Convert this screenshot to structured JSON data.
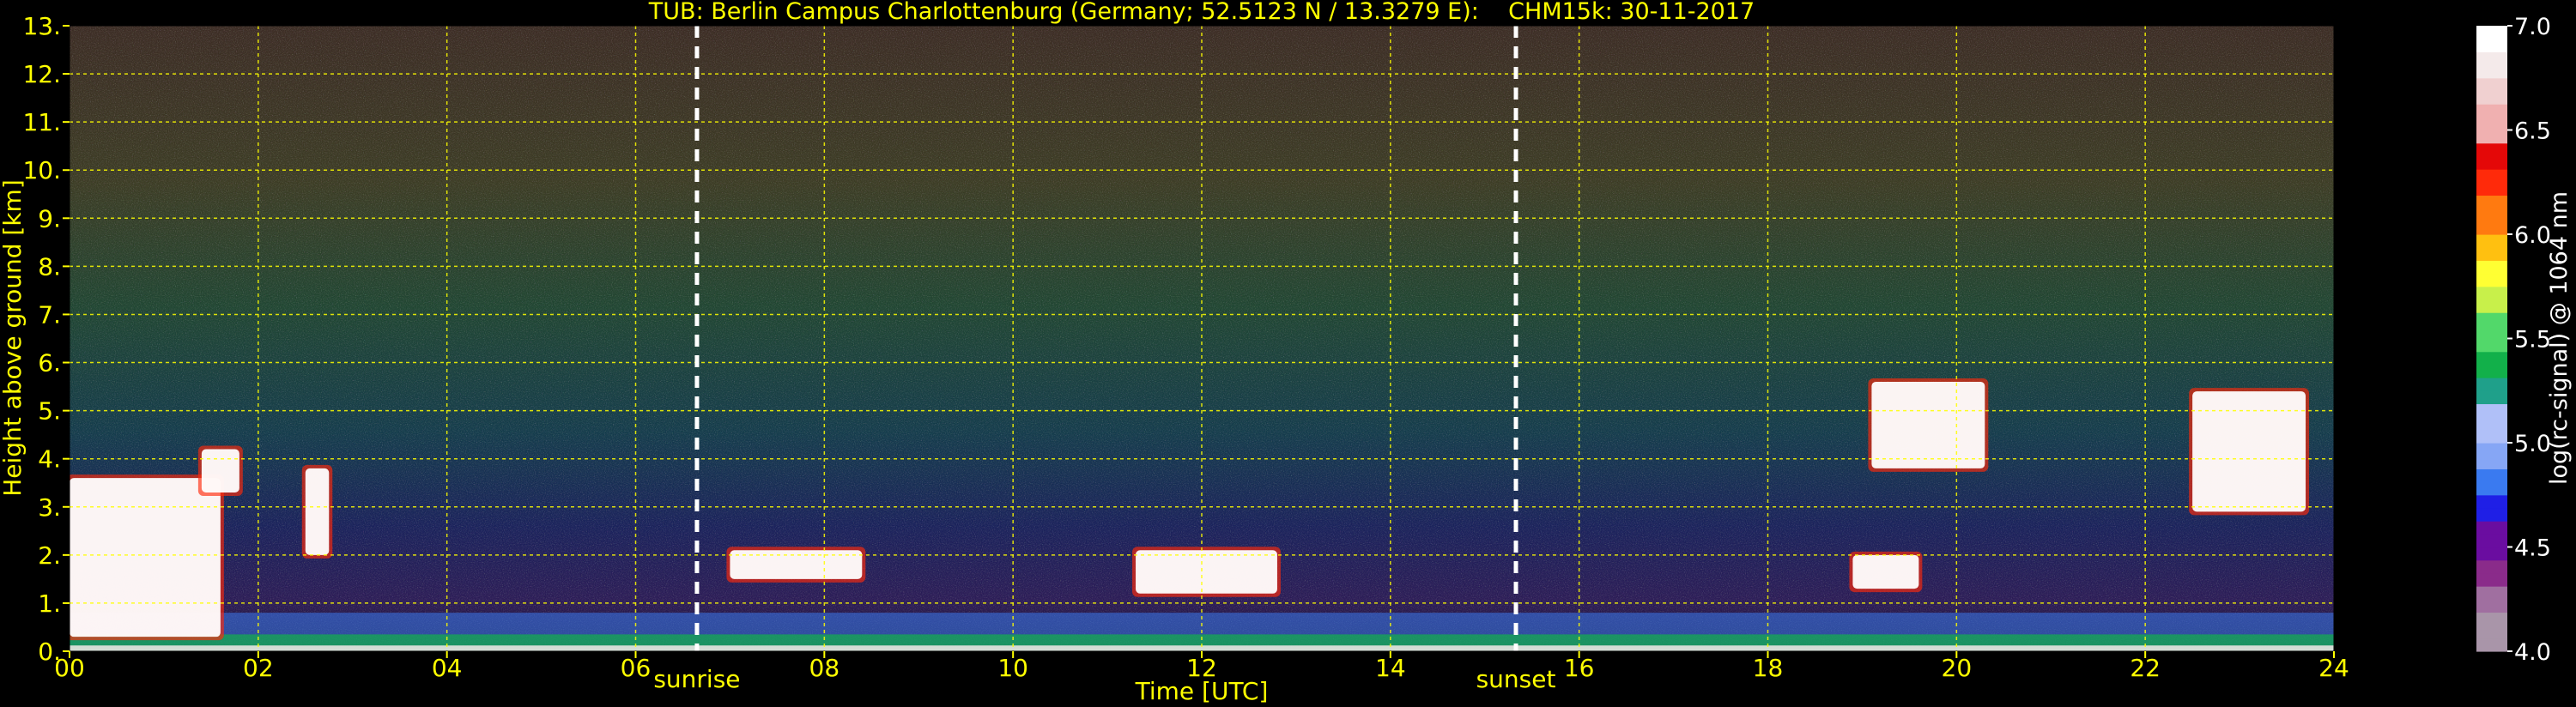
{
  "chart_data": {
    "type": "heatmap",
    "title": "TUB: Berlin Campus Charlottenburg (Germany; 52.5123 N / 13.3279 E):    CHM15k: 30-11-2017",
    "xlabel": "Time [UTC]",
    "ylabel": "Height above ground [km]",
    "xlim": [
      0,
      24
    ],
    "ylim": [
      0,
      13
    ],
    "x_ticks": [
      "00",
      "02",
      "04",
      "06",
      "08",
      "10",
      "12",
      "14",
      "16",
      "18",
      "20",
      "22",
      "24"
    ],
    "y_ticks": [
      "0.",
      "1.",
      "2.",
      "3.",
      "4.",
      "5.",
      "6.",
      "7.",
      "8.",
      "9.",
      "10.",
      "11.",
      "12.",
      "13."
    ],
    "grid": true,
    "markers": [
      {
        "label": "sunrise",
        "time_utc": 6.65
      },
      {
        "label": "sunset",
        "time_utc": 15.33
      }
    ],
    "colorbar": {
      "label": "log(rc-signal) @ 1064 nm",
      "range": [
        4.0,
        7.0
      ],
      "ticks": [
        "4.0",
        "4.5",
        "5.0",
        "5.5",
        "6.0",
        "6.5",
        "7.0"
      ]
    },
    "features": [
      {
        "name": "boundary layer",
        "t": [
          0,
          24
        ],
        "h": [
          0.0,
          0.8
        ]
      },
      {
        "name": "low cloud",
        "t": [
          0.0,
          1.6
        ],
        "h": [
          0.3,
          3.6
        ]
      },
      {
        "name": "cloud",
        "t": [
          1.4,
          1.8
        ],
        "h": [
          3.3,
          4.2
        ]
      },
      {
        "name": "cloud",
        "t": [
          2.5,
          2.75
        ],
        "h": [
          2.0,
          3.8
        ]
      },
      {
        "name": "cloud",
        "t": [
          7.0,
          8.4
        ],
        "h": [
          1.5,
          2.1
        ]
      },
      {
        "name": "cloud",
        "t": [
          11.3,
          12.8
        ],
        "h": [
          1.2,
          2.1
        ]
      },
      {
        "name": "cloud",
        "t": [
          18.9,
          19.6
        ],
        "h": [
          1.3,
          2.0
        ]
      },
      {
        "name": "mid cloud",
        "t": [
          19.1,
          20.3
        ],
        "h": [
          3.8,
          5.6
        ]
      },
      {
        "name": "mid cloud",
        "t": [
          22.5,
          23.7
        ],
        "h": [
          2.9,
          5.4
        ]
      }
    ]
  },
  "colors": {
    "axis_text": "#ffff00",
    "grid": "#ffff00",
    "background": "#000000",
    "colormap": [
      "#a995a9",
      "#a06fa0",
      "#8a2b8a",
      "#6a0da0",
      "#1f1fe6",
      "#3a7af0",
      "#86a6f5",
      "#b0c0f8",
      "#1fa08a",
      "#12b04a",
      "#52d86a",
      "#c8f04a",
      "#ffff33",
      "#ffc010",
      "#ff7a10",
      "#ff2a0a",
      "#e40808",
      "#f0b0b0",
      "#f0d0d0",
      "#f4eaea",
      "#ffffff"
    ]
  }
}
